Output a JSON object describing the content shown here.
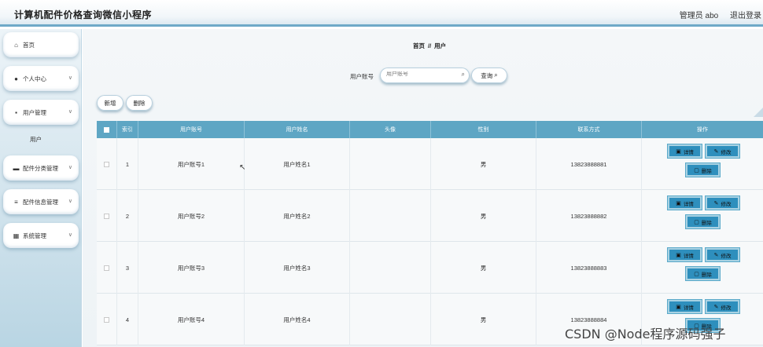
{
  "header": {
    "title": "计算机配件价格查询微信小程序",
    "user_label": "管理员 abo",
    "logout": "退出登录"
  },
  "sidebar": {
    "items": [
      {
        "label": "首页",
        "icon": "home-icon"
      },
      {
        "label": "个人中心",
        "icon": "user-icon"
      },
      {
        "label": "用户管理",
        "icon": "grid-icon"
      },
      {
        "label": "配件分类管理",
        "icon": "chat-icon"
      },
      {
        "label": "配件信息管理",
        "icon": "list-icon"
      },
      {
        "label": "系统管理",
        "icon": "grid-icon"
      }
    ],
    "sub_item": "用户"
  },
  "breadcrumb": {
    "home": "首页",
    "sep": "//",
    "current": "用户"
  },
  "search": {
    "label": "用户账号",
    "placeholder": "用户账号",
    "button": "查询"
  },
  "actions": {
    "add": "新增",
    "delete": "删除"
  },
  "table": {
    "headers": [
      "索引",
      "用户账号",
      "用户姓名",
      "头像",
      "性别",
      "联系方式",
      "操作"
    ],
    "rows": [
      {
        "index": "1",
        "account": "用户账号1",
        "name": "用户姓名1",
        "avatar": "",
        "gender": "男",
        "phone": "13823888881"
      },
      {
        "index": "2",
        "account": "用户账号2",
        "name": "用户姓名2",
        "avatar": "",
        "gender": "男",
        "phone": "13823888882"
      },
      {
        "index": "3",
        "account": "用户账号3",
        "name": "用户姓名3",
        "avatar": "",
        "gender": "男",
        "phone": "13823888883"
      },
      {
        "index": "4",
        "account": "用户账号4",
        "name": "用户姓名4",
        "avatar": "",
        "gender": "男",
        "phone": "13823888884"
      }
    ],
    "ops": {
      "detail": "详情",
      "edit": "修改",
      "remove": "删除"
    }
  },
  "watermark": "CSDN @Node程序源码强子",
  "colors": {
    "header_accent": "#6fa9c8",
    "table_header": "#5ea6c4",
    "op_button": "#2e8fbd"
  }
}
